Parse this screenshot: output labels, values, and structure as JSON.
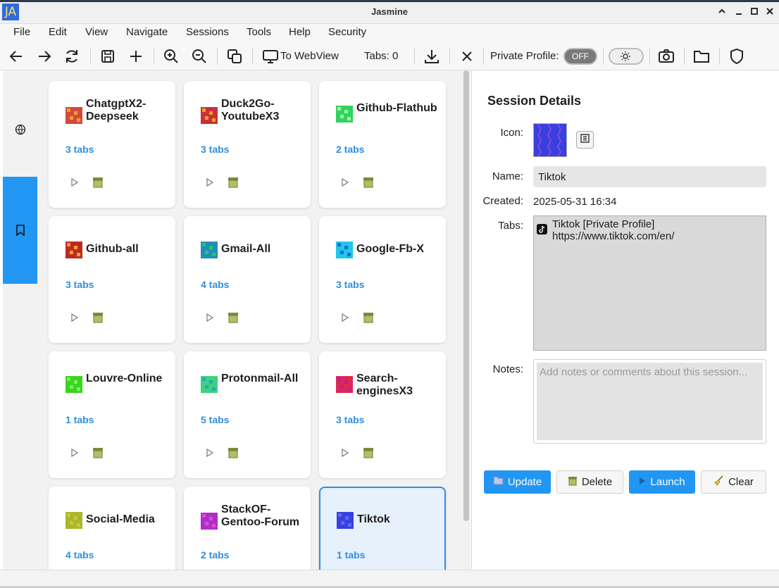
{
  "window": {
    "title": "Jasmine",
    "app_badge": "JA",
    "controls": [
      "^",
      "_",
      "□",
      "×"
    ]
  },
  "menu": [
    "File",
    "Edit",
    "View",
    "Navigate",
    "Sessions",
    "Tools",
    "Help",
    "Security"
  ],
  "toolbar": {
    "to_webview_label": "To WebView",
    "tabs_count_label": "Tabs: 0",
    "private_profile_label": "Private Profile:",
    "private_toggle_state": "OFF"
  },
  "sessions": [
    {
      "name": "ChatgptX2-Deepseek",
      "tabs": "3 tabs",
      "icon_color": "#d24a3a",
      "icon_alt": "#f29c2b",
      "selected": false
    },
    {
      "name": "Duck2Go-YoutubeX3",
      "tabs": "3 tabs",
      "icon_color": "#c92f3c",
      "icon_alt": "#f0a020",
      "selected": false
    },
    {
      "name": "Github-Flathub",
      "tabs": "2 tabs",
      "icon_color": "#2fd45a",
      "icon_alt": "#a8f0c0",
      "selected": false
    },
    {
      "name": "Github-all",
      "tabs": "3 tabs",
      "icon_color": "#c0281d",
      "icon_alt": "#f2a13a",
      "selected": false
    },
    {
      "name": "Gmail-All",
      "tabs": "4 tabs",
      "icon_color": "#1f8fb8",
      "icon_alt": "#30c070",
      "selected": false
    },
    {
      "name": "Google-Fb-X",
      "tabs": "3 tabs",
      "icon_color": "#20c8e8",
      "icon_alt": "#1a66d8",
      "selected": false
    },
    {
      "name": "Louvre-Online",
      "tabs": "1 tabs",
      "icon_color": "#38d51c",
      "icon_alt": "#7df060",
      "selected": false
    },
    {
      "name": "Protonmail-All",
      "tabs": "5 tabs",
      "icon_color": "#3ed27c",
      "icon_alt": "#2aa5c8",
      "selected": false
    },
    {
      "name": "Search-enginesX3",
      "tabs": "3 tabs",
      "icon_color": "#e0284f",
      "icon_alt": "#b820a0",
      "selected": false
    },
    {
      "name": "Social-Media",
      "tabs": "4 tabs",
      "icon_color": "#a8b82a",
      "icon_alt": "#d4c040",
      "selected": false
    },
    {
      "name": "StackOF-Gentoo-Forum",
      "tabs": "2 tabs",
      "icon_color": "#b02ec8",
      "icon_alt": "#e04ad0",
      "selected": false
    },
    {
      "name": "Tiktok",
      "tabs": "1 tabs",
      "icon_color": "#3a3fe0",
      "icon_alt": "#5a6af0",
      "selected": true
    }
  ],
  "details": {
    "title": "Session Details",
    "icon_label": "Icon:",
    "name_label": "Name:",
    "name_value": "Tiktok",
    "created_label": "Created:",
    "created_value": "2025-05-31 16:34",
    "tabs_label": "Tabs:",
    "tab_entries": [
      {
        "title": "Tiktok [Private Profile]",
        "url": "https://www.tiktok.com/en/"
      }
    ],
    "notes_label": "Notes:",
    "notes_placeholder": "Add notes or comments about this session...",
    "buttons": {
      "update": "Update",
      "delete": "Delete",
      "launch": "Launch",
      "clear": "Clear"
    }
  },
  "colors": {
    "accent": "#2196f3",
    "tabs_text": "#2f8fe0",
    "selected_card_bg": "#e6f1fb"
  }
}
